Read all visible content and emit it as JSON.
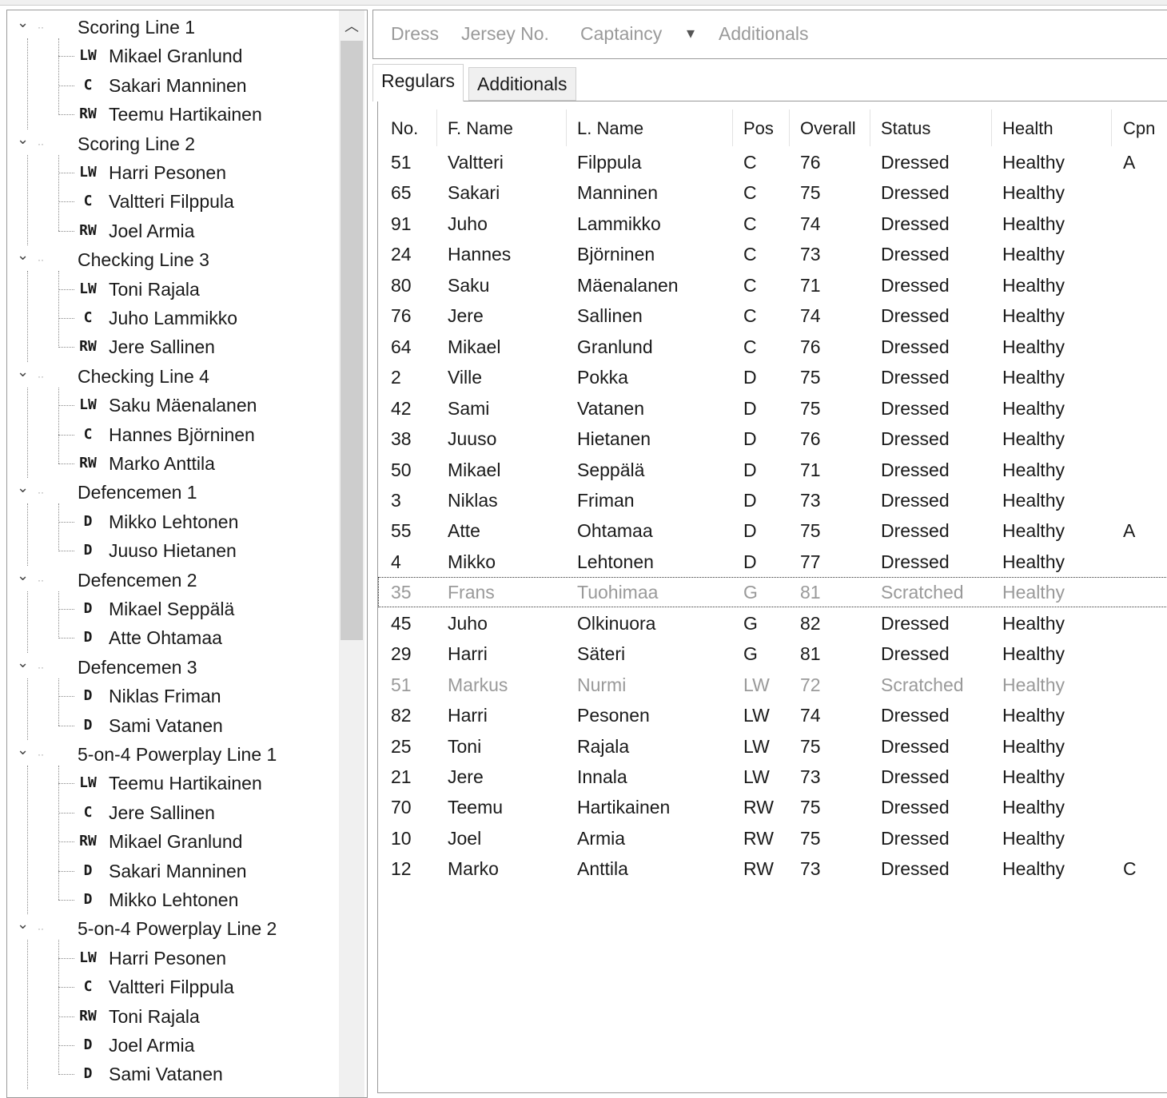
{
  "tree": {
    "groups": [
      {
        "label": "Scoring Line 1",
        "players": [
          {
            "pos": "LW",
            "name": "Mikael Granlund"
          },
          {
            "pos": "C",
            "name": "Sakari Manninen"
          },
          {
            "pos": "RW",
            "name": "Teemu Hartikainen"
          }
        ]
      },
      {
        "label": "Scoring Line 2",
        "players": [
          {
            "pos": "LW",
            "name": "Harri Pesonen"
          },
          {
            "pos": "C",
            "name": "Valtteri Filppula"
          },
          {
            "pos": "RW",
            "name": "Joel Armia"
          }
        ]
      },
      {
        "label": "Checking Line 3",
        "players": [
          {
            "pos": "LW",
            "name": "Toni Rajala"
          },
          {
            "pos": "C",
            "name": "Juho Lammikko"
          },
          {
            "pos": "RW",
            "name": "Jere Sallinen"
          }
        ]
      },
      {
        "label": "Checking Line 4",
        "players": [
          {
            "pos": "LW",
            "name": "Saku Mäenalanen"
          },
          {
            "pos": "C",
            "name": "Hannes Björninen"
          },
          {
            "pos": "RW",
            "name": "Marko Anttila"
          }
        ]
      },
      {
        "label": "Defencemen 1",
        "players": [
          {
            "pos": "D",
            "name": "Mikko Lehtonen"
          },
          {
            "pos": "D",
            "name": "Juuso Hietanen"
          }
        ]
      },
      {
        "label": "Defencemen 2",
        "players": [
          {
            "pos": "D",
            "name": "Mikael Seppälä"
          },
          {
            "pos": "D",
            "name": "Atte Ohtamaa"
          }
        ]
      },
      {
        "label": "Defencemen 3",
        "players": [
          {
            "pos": "D",
            "name": "Niklas Friman"
          },
          {
            "pos": "D",
            "name": "Sami Vatanen"
          }
        ]
      },
      {
        "label": "5-on-4 Powerplay Line 1",
        "players": [
          {
            "pos": "LW",
            "name": "Teemu Hartikainen"
          },
          {
            "pos": "C",
            "name": "Jere Sallinen"
          },
          {
            "pos": "RW",
            "name": "Mikael Granlund"
          },
          {
            "pos": "D",
            "name": "Sakari Manninen"
          },
          {
            "pos": "D",
            "name": "Mikko Lehtonen"
          }
        ]
      },
      {
        "label": "5-on-4 Powerplay Line 2",
        "players": [
          {
            "pos": "LW",
            "name": "Harri Pesonen"
          },
          {
            "pos": "C",
            "name": "Valtteri Filppula"
          },
          {
            "pos": "RW",
            "name": "Toni Rajala"
          },
          {
            "pos": "D",
            "name": "Joel Armia"
          },
          {
            "pos": "D",
            "name": "Sami Vatanen"
          }
        ]
      }
    ]
  },
  "toolbar": {
    "dress": "Dress",
    "jersey": "Jersey No.",
    "captaincy": "Captaincy",
    "dropdown_arrow": "▾",
    "additionals": "Additionals"
  },
  "tabs": {
    "regulars": "Regulars",
    "additionals": "Additionals"
  },
  "table": {
    "columns": [
      "No.",
      "F. Name",
      "L. Name",
      "Pos",
      "Overall",
      "Status",
      "Health",
      "Cpn"
    ],
    "rows": [
      [
        "51",
        "Valtteri",
        "Filppula",
        "C",
        "76",
        "Dressed",
        "Healthy",
        "A"
      ],
      [
        "65",
        "Sakari",
        "Manninen",
        "C",
        "75",
        "Dressed",
        "Healthy",
        ""
      ],
      [
        "91",
        "Juho",
        "Lammikko",
        "C",
        "74",
        "Dressed",
        "Healthy",
        ""
      ],
      [
        "24",
        "Hannes",
        "Björninen",
        "C",
        "73",
        "Dressed",
        "Healthy",
        ""
      ],
      [
        "80",
        "Saku",
        "Mäenalanen",
        "C",
        "71",
        "Dressed",
        "Healthy",
        ""
      ],
      [
        "76",
        "Jere",
        "Sallinen",
        "C",
        "74",
        "Dressed",
        "Healthy",
        ""
      ],
      [
        "64",
        "Mikael",
        "Granlund",
        "C",
        "76",
        "Dressed",
        "Healthy",
        ""
      ],
      [
        "2",
        "Ville",
        "Pokka",
        "D",
        "75",
        "Dressed",
        "Healthy",
        ""
      ],
      [
        "42",
        "Sami",
        "Vatanen",
        "D",
        "75",
        "Dressed",
        "Healthy",
        ""
      ],
      [
        "38",
        "Juuso",
        "Hietanen",
        "D",
        "76",
        "Dressed",
        "Healthy",
        ""
      ],
      [
        "50",
        "Mikael",
        "Seppälä",
        "D",
        "71",
        "Dressed",
        "Healthy",
        ""
      ],
      [
        "3",
        "Niklas",
        "Friman",
        "D",
        "73",
        "Dressed",
        "Healthy",
        ""
      ],
      [
        "55",
        "Atte",
        "Ohtamaa",
        "D",
        "75",
        "Dressed",
        "Healthy",
        "A"
      ],
      [
        "4",
        "Mikko",
        "Lehtonen",
        "D",
        "77",
        "Dressed",
        "Healthy",
        ""
      ],
      [
        "35",
        "Frans",
        "Tuohimaa",
        "G",
        "81",
        "Scratched",
        "Healthy",
        ""
      ],
      [
        "45",
        "Juho",
        "Olkinuora",
        "G",
        "82",
        "Dressed",
        "Healthy",
        ""
      ],
      [
        "29",
        "Harri",
        "Säteri",
        "G",
        "81",
        "Dressed",
        "Healthy",
        ""
      ],
      [
        "51",
        "Markus",
        "Nurmi",
        "LW",
        "72",
        "Scratched",
        "Healthy",
        ""
      ],
      [
        "82",
        "Harri",
        "Pesonen",
        "LW",
        "74",
        "Dressed",
        "Healthy",
        ""
      ],
      [
        "25",
        "Toni",
        "Rajala",
        "LW",
        "75",
        "Dressed",
        "Healthy",
        ""
      ],
      [
        "21",
        "Jere",
        "Innala",
        "LW",
        "73",
        "Dressed",
        "Healthy",
        ""
      ],
      [
        "70",
        "Teemu",
        "Hartikainen",
        "RW",
        "75",
        "Dressed",
        "Healthy",
        ""
      ],
      [
        "10",
        "Joel",
        "Armia",
        "RW",
        "75",
        "Dressed",
        "Healthy",
        ""
      ],
      [
        "12",
        "Marko",
        "Anttila",
        "RW",
        "73",
        "Dressed",
        "Healthy",
        "C"
      ]
    ],
    "selected_row": 14
  }
}
